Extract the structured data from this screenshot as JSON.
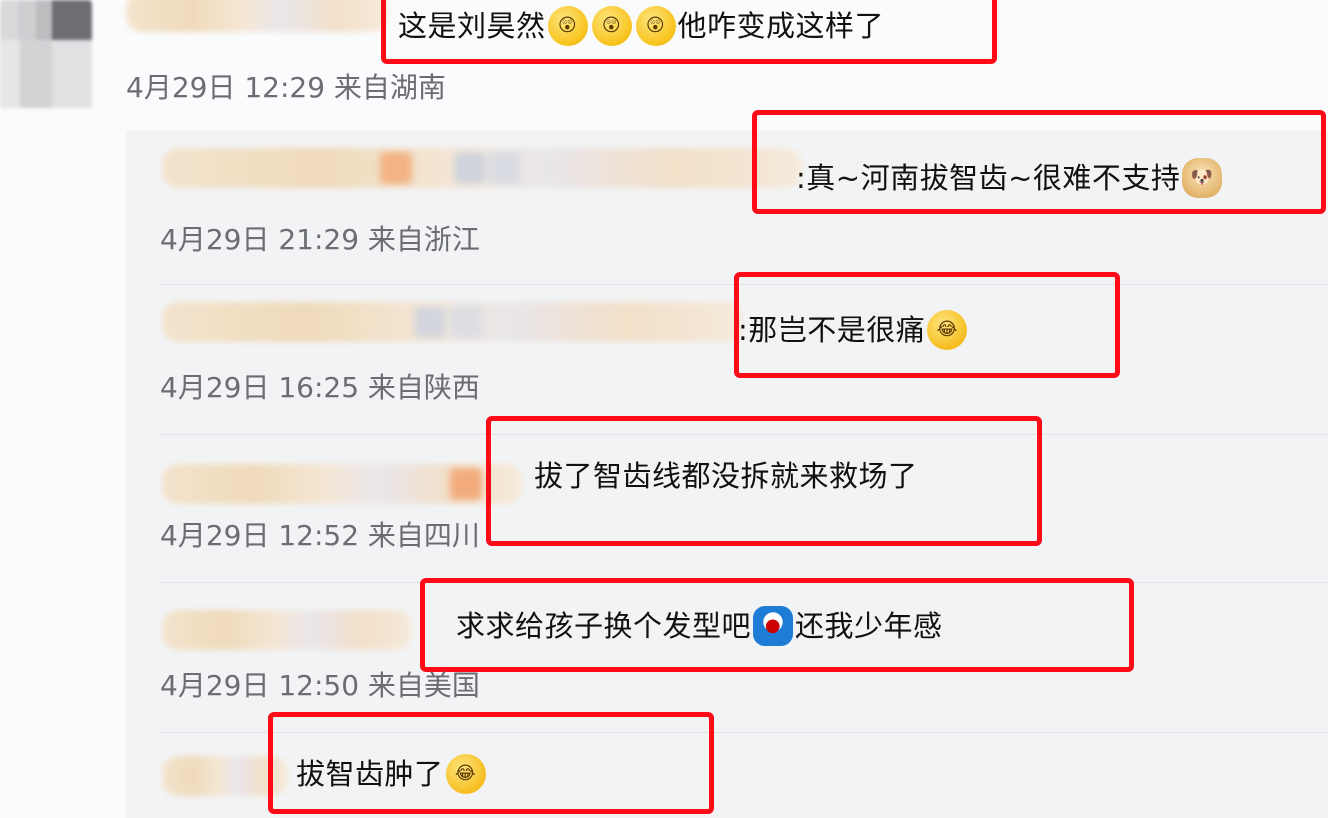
{
  "top_comment": {
    "text": "这是刘昊然",
    "emojis": [
      "astonished-face",
      "astonished-face",
      "astonished-face"
    ],
    "text_after": "他咋变成这样了",
    "meta": "4月29日 12:29 来自湖南"
  },
  "replies": [
    {
      "prefix": ":",
      "text": "真~河南拔智齿~很难不支持",
      "emoji": "doge-face",
      "meta": "4月29日 21:29 来自浙江"
    },
    {
      "prefix": ":",
      "text": "那岂不是很痛",
      "emoji": "laugh-cry-face",
      "meta": "4月29日 16:25 来自陕西"
    },
    {
      "prefix": "",
      "text": "拔了智齿线都没拆就来救场了",
      "emoji": "",
      "meta": "4月29日 12:52 来自四川"
    },
    {
      "prefix": "",
      "text": "求求给孩子换个发型吧",
      "emoji": "doraemon-face",
      "text_after": "还我少年感",
      "meta": "4月29日 12:50 来自美国"
    },
    {
      "prefix": "",
      "text": "拔智齿肿了",
      "emoji": "laugh-cry-face",
      "meta": ""
    }
  ],
  "colors": {
    "highlight_box": "#ff0a17",
    "meta_text": "#6b6d72",
    "reply_background": "#f2f3f5"
  }
}
